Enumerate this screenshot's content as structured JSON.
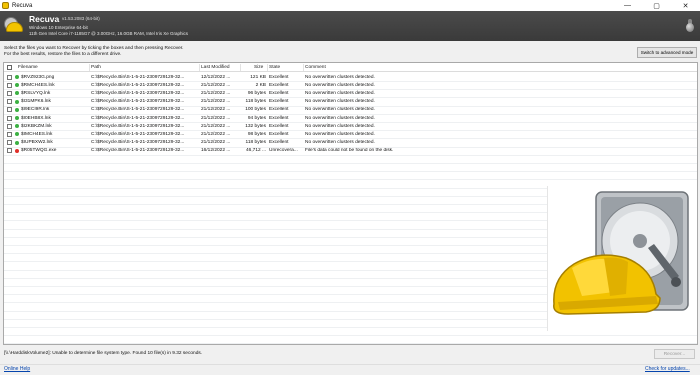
{
  "window": {
    "title": "Recuva",
    "minimize_glyph": "—",
    "maximize_glyph": "▢",
    "close_glyph": "✕"
  },
  "header": {
    "app_name": "Recuva",
    "version": "v1.53.2083 (64-bit)",
    "os": "Windows 10 Enterprise 64-bit",
    "cpu": "11th Gen Intel Core i7-1185G7 @ 3.00GHz, 16.0GB RAM, Intel Iris Xe Graphics"
  },
  "instructions": {
    "line1": "Select the files you want to Recover by ticking the boxes and then pressing Recover.",
    "line2": "For the best results, restore the files to a different drive."
  },
  "advanced_button": "Switch to advanced mode",
  "table": {
    "columns": {
      "filename": "Filename",
      "path": "Path",
      "last_modified": "Last Modified",
      "size": "Size",
      "state": "State",
      "comment": "Comment"
    },
    "rows": [
      {
        "filename": "$RVZ923G.png",
        "path": "C:\\$Recycle.Bin\\S-1-5-21-2309729129-32...",
        "modified": "12/12/2022 ...",
        "size": "121 KB",
        "state": "Excellent",
        "comment": "No overwritten clusters detected.",
        "status": "good"
      },
      {
        "filename": "$RMCH4ES.lnk",
        "path": "C:\\$Recycle.Bin\\S-1-5-21-2309729129-32...",
        "modified": "21/12/2022 ...",
        "size": "2 KB",
        "state": "Excellent",
        "comment": "No overwritten clusters detected.",
        "status": "good"
      },
      {
        "filename": "$RSLVYQ.lnk",
        "path": "C:\\$Recycle.Bin\\S-1-5-21-2309729129-32...",
        "modified": "21/12/2022 ...",
        "size": "96 bytes",
        "state": "Excellent",
        "comment": "No overwritten clusters detected.",
        "status": "good"
      },
      {
        "filename": "$I31MPK6.lnk",
        "path": "C:\\$Recycle.Bin\\S-1-5-21-2309729129-32...",
        "modified": "21/12/2022 ...",
        "size": "118 bytes",
        "state": "Excellent",
        "comment": "No overwritten clusters detected.",
        "status": "good"
      },
      {
        "filename": "$I9ECI9R.lnk",
        "path": "C:\\$Recycle.Bin\\S-1-5-21-2309729129-32...",
        "modified": "21/12/2022 ...",
        "size": "100 bytes",
        "state": "Excellent",
        "comment": "No overwritten clusters detected.",
        "status": "good"
      },
      {
        "filename": "$I0EHB8X.lnk",
        "path": "C:\\$Recycle.Bin\\S-1-5-21-2309729129-32...",
        "modified": "21/12/2022 ...",
        "size": "94 bytes",
        "state": "Excellent",
        "comment": "No overwritten clusters detected.",
        "status": "good"
      },
      {
        "filename": "$I2KBKZM.lnk",
        "path": "C:\\$Recycle.Bin\\S-1-5-21-2309729129-32...",
        "modified": "21/12/2022 ...",
        "size": "132 bytes",
        "state": "Excellent",
        "comment": "No overwritten clusters detected.",
        "status": "good"
      },
      {
        "filename": "$IMCH4ES.lnk",
        "path": "C:\\$Recycle.Bin\\S-1-5-21-2309729129-32...",
        "modified": "21/12/2022 ...",
        "size": "98 bytes",
        "state": "Excellent",
        "comment": "No overwritten clusters detected.",
        "status": "good"
      },
      {
        "filename": "$IUPBXW2.lnk",
        "path": "C:\\$Recycle.Bin\\S-1-5-21-2309729129-32...",
        "modified": "21/12/2022 ...",
        "size": "118 bytes",
        "state": "Excellent",
        "comment": "No overwritten clusters detected.",
        "status": "good"
      },
      {
        "filename": "$R05TWQG.exe",
        "path": "C:\\$Recycle.Bin\\S-1-5-21-2309729129-32...",
        "modified": "16/12/2022 ...",
        "size": "46,712 ...",
        "state": "Unrecovera...",
        "comment": "File's data could not be found on the disk.",
        "status": "bad"
      }
    ]
  },
  "status_bar": {
    "text": "[\\\\.\\HarddiskVolume2]: Unable to determine file system type. Found 10 file(s) in 9.32 seconds."
  },
  "recover_button": "Recover...",
  "links": {
    "help": "Online Help",
    "updates": "Check for updates..."
  },
  "colors": {
    "good": "#3cb043",
    "bad": "#e0302a",
    "accent": "#f2c200"
  }
}
